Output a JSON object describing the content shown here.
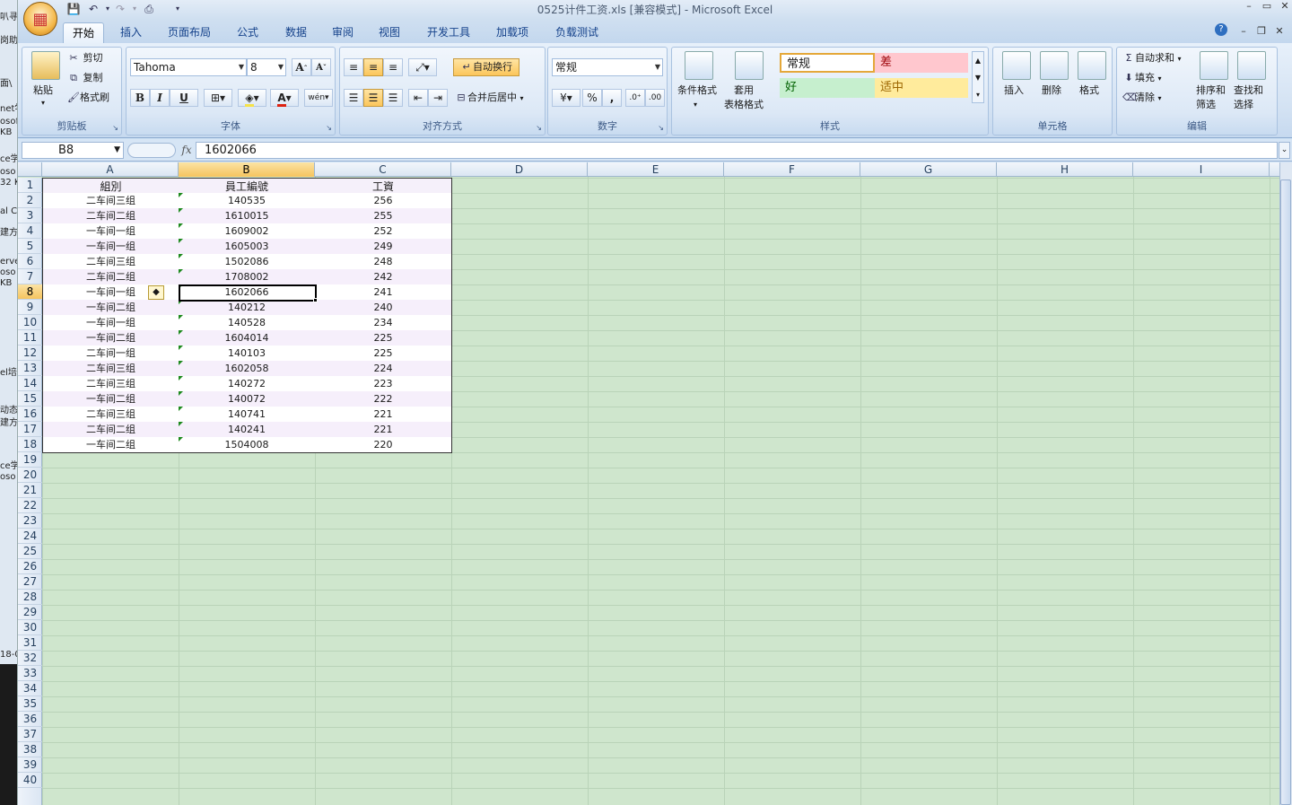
{
  "window": {
    "title": "0525计件工资.xls  [兼容模式] - Microsoft Excel",
    "controls": [
      "–",
      "▭",
      "✕"
    ],
    "doc_controls": [
      "–",
      "❐",
      "✕"
    ]
  },
  "desktop_fragments": [
    "叭寻",
    "岗助",
    "面\\",
    "net学",
    "osof",
    "KB",
    "ce学",
    "oso",
    "32 K",
    "al C",
    "建方",
    "erve",
    "oso",
    "KB",
    "el培",
    "动态",
    "建方",
    "ce学",
    "oso",
    "18-0"
  ],
  "tabs": [
    "开始",
    "插入",
    "页面布局",
    "公式",
    "数据",
    "审阅",
    "视图",
    "开发工具",
    "加载项",
    "负载测试"
  ],
  "active_tab": "开始",
  "ribbon": {
    "clipboard": {
      "label": "剪贴板",
      "paste": "粘贴",
      "cut": "剪切",
      "copy": "复制",
      "format_painter": "格式刷"
    },
    "font": {
      "label": "字体",
      "name": "Tahoma",
      "size": "8",
      "bold": "B",
      "italic": "I",
      "underline": "U",
      "phonetic": "wén"
    },
    "alignment": {
      "label": "对齐方式",
      "wrap": "自动换行",
      "merge": "合并后居中"
    },
    "number": {
      "label": "数字",
      "format": "常规",
      "percent": "%",
      "comma": ","
    },
    "styles": {
      "label": "样式",
      "cond_format": "条件格式",
      "table_format": "套用\n表格格式",
      "normal": "常规",
      "bad": "差",
      "good": "好",
      "neutral": "适中"
    },
    "cells": {
      "label": "单元格",
      "insert": "插入",
      "delete": "删除",
      "format": "格式"
    },
    "editing": {
      "label": "编辑",
      "autosum": "自动求和",
      "fill": "填充",
      "clear": "清除",
      "sort": "排序和\n筛选",
      "find": "查找和\n选择"
    }
  },
  "formula_bar": {
    "name_box": "B8",
    "fx": "fx",
    "content": "1602066"
  },
  "columns": [
    "A",
    "B",
    "C",
    "D",
    "E",
    "F",
    "G",
    "H",
    "I"
  ],
  "selected_column": "B",
  "selected_row": 8,
  "row_count": 40,
  "table": {
    "headers": [
      "組別",
      "員工編號",
      "工資"
    ],
    "rows": [
      [
        "二车间三组",
        "140535",
        "256"
      ],
      [
        "二车间二组",
        "1610015",
        "255"
      ],
      [
        "一车间一组",
        "1609002",
        "252"
      ],
      [
        "一车间一组",
        "1605003",
        "249"
      ],
      [
        "二车间三组",
        "1502086",
        "248"
      ],
      [
        "二车间二组",
        "1708002",
        "242"
      ],
      [
        "一车间一组",
        "1602066",
        "241"
      ],
      [
        "一车间二组",
        "140212",
        "240"
      ],
      [
        "一车间一组",
        "140528",
        "234"
      ],
      [
        "一车间二组",
        "1604014",
        "225"
      ],
      [
        "二车间一组",
        "140103",
        "225"
      ],
      [
        "二车间三组",
        "1602058",
        "224"
      ],
      [
        "二车间三组",
        "140272",
        "223"
      ],
      [
        "一车间二组",
        "140072",
        "222"
      ],
      [
        "二车间三组",
        "140741",
        "221"
      ],
      [
        "二车间二组",
        "140241",
        "221"
      ],
      [
        "一车间二组",
        "1504008",
        "220"
      ]
    ]
  },
  "colors": {
    "grid_bg": "#cfe6cd",
    "selected_header": "#f5c45f",
    "ribbon": "#dce8f6"
  }
}
